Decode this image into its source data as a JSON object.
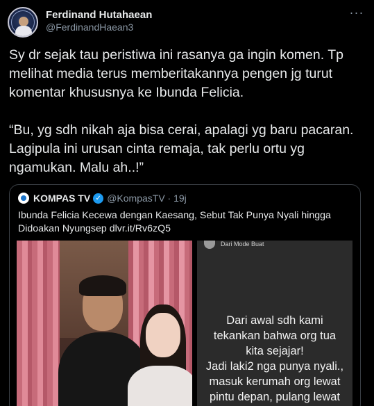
{
  "tweet": {
    "author_name": "Ferdinand Hutahaean",
    "author_handle": "@FerdinandHaean3",
    "more_label": "···",
    "text": "Sy dr sejak tau peristiwa ini rasanya ga ingin komen. Tp melihat media terus memberitakannya pengen jg turut komentar khususnya ke Ibunda Felicia.\n\n“Bu, yg sdh nikah aja bisa cerai, apalagi yg baru pacaran. Lagipula ini urusan cinta remaja, tak perlu ortu yg ngamukan. Malu ah..!”"
  },
  "quoted": {
    "source_name": "KOMPAS TV",
    "verified_mark": "✓",
    "handle_time": "@KompasTV · 19j",
    "text": "Ibunda Felicia Kecewa dengan Kaesang, Sebut Tak Punya Nyali hingga Didoakan Nyungsep dlvr.it/Rv6zQ5",
    "image_right": {
      "header": "Dari Mode Buat",
      "message": "Dari awal sdh kami\ntekankan bahwa org tua\nkita sejajar!\nJadi laki2 nga punya nyali.,\nmasuk kerumah org lewat\npintu depan, pulang lewat\njendela. Nyungsep loh"
    }
  },
  "icons": {
    "more": "more-options-icon",
    "verified": "verified-badge-icon",
    "logo": "kompas-logo-icon"
  },
  "colors": {
    "background": "#000000",
    "text": "#e7e9ea",
    "secondary_text": "#8b98a5",
    "verified": "#1d9bf0",
    "border": "#3a3f45"
  }
}
